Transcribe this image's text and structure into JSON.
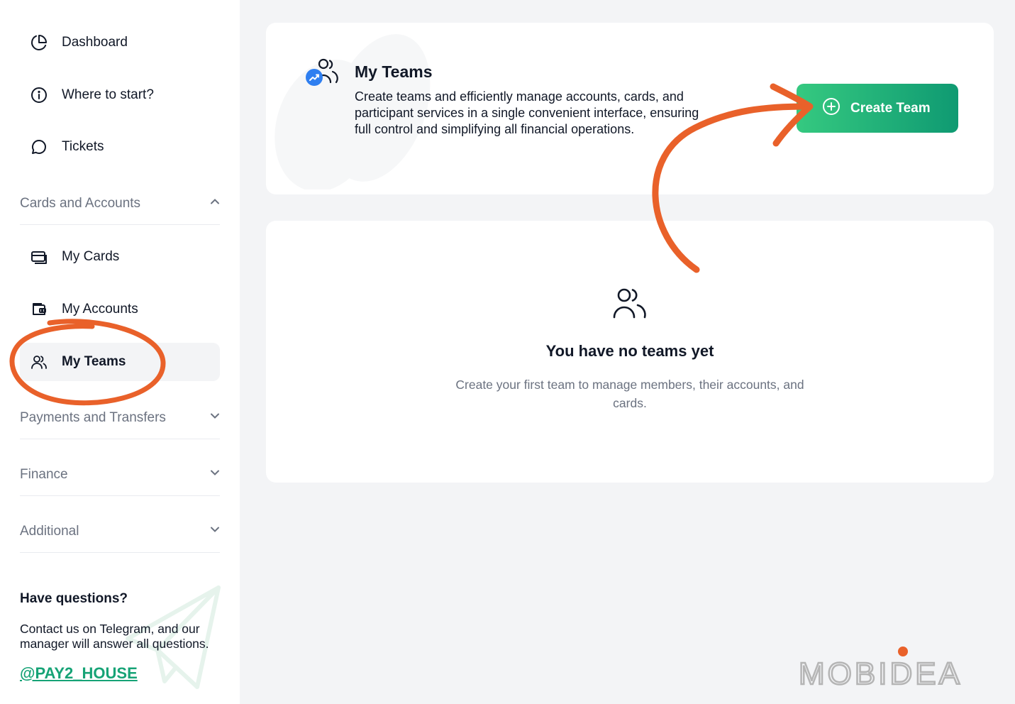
{
  "sidebar": {
    "items_top": [
      {
        "label": "Dashboard",
        "icon": "pie-chart-icon"
      },
      {
        "label": "Where to start?",
        "icon": "info-icon"
      },
      {
        "label": "Tickets",
        "icon": "chat-bubble-icon"
      }
    ],
    "sections": {
      "cards_accounts": "Cards and Accounts",
      "payments": "Payments and Transfers",
      "finance": "Finance",
      "additional": "Additional"
    },
    "sub_items": [
      {
        "label": "My Cards",
        "icon": "card-icon"
      },
      {
        "label": "My Accounts",
        "icon": "wallet-icon"
      },
      {
        "label": "My Teams",
        "icon": "users-icon",
        "active": true
      }
    ],
    "help": {
      "title": "Have questions?",
      "text": "Contact us on Telegram, and our manager will answer all questions.",
      "link": "@PAY2_HOUSE"
    }
  },
  "hero": {
    "title": "My Teams",
    "description": "Create teams and efficiently manage accounts, cards, and participant services in a single convenient interface, ensuring full control and simplifying all financial operations.",
    "button_label": "Create Team"
  },
  "empty_state": {
    "title": "You have no teams yet",
    "description": "Create your first team to manage members, their accounts, and cards."
  },
  "watermark": "MOBIDEA",
  "colors": {
    "accent_green_start": "#35c980",
    "accent_green_end": "#0f9a72",
    "annotation_orange": "#e9612a",
    "link_green": "#16a376",
    "background": "#f3f4f6"
  }
}
